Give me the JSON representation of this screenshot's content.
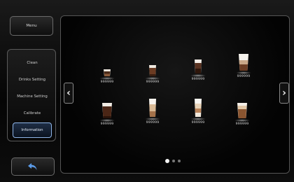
{
  "sidebar": {
    "menu_label": "Menu",
    "items": [
      {
        "label": "Clean",
        "active": false
      },
      {
        "label": "Drinks Setting",
        "active": false
      },
      {
        "label": "Machine Setting",
        "active": false
      },
      {
        "label": "Calibrate",
        "active": false
      },
      {
        "label": "Information",
        "active": true
      }
    ]
  },
  "drinks": [
    {
      "label": "999999",
      "icon": "espresso-cup-icon"
    },
    {
      "label": "999999",
      "icon": "coffee-cup-icon"
    },
    {
      "label": "999999",
      "icon": "mocha-glass-icon"
    },
    {
      "label": "999999",
      "icon": "cappuccino-glass-icon"
    },
    {
      "label": "999999",
      "icon": "americano-glass-icon"
    },
    {
      "label": "999999",
      "icon": "latte-glass-icon"
    },
    {
      "label": "999999",
      "icon": "latte-macchiato-glass-icon"
    },
    {
      "label": "999999",
      "icon": "flat-white-glass-icon"
    }
  ],
  "pagination": {
    "pages": 3,
    "current": 1
  },
  "colors": {
    "accent": "#8fb5e8",
    "panel_border": "#555555",
    "text": "#d8d8d8"
  }
}
